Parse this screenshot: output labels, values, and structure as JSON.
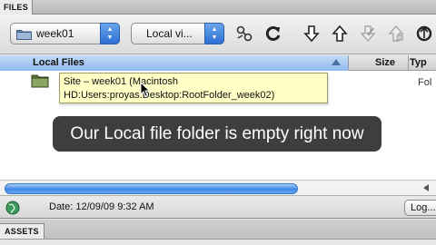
{
  "panel": {
    "tab_label": "FILES"
  },
  "toolbar": {
    "site_select": {
      "value": "week01",
      "icon": "folder-icon"
    },
    "view_select": {
      "value": "Local vi..."
    },
    "buttons": [
      {
        "name": "connect-icon"
      },
      {
        "name": "refresh-icon"
      },
      {
        "name": "get-files-icon"
      },
      {
        "name": "put-files-icon"
      },
      {
        "name": "check-out-icon"
      },
      {
        "name": "check-in-icon"
      },
      {
        "name": "synchronize-icon"
      }
    ]
  },
  "columns": {
    "local_files": "Local Files",
    "size": "Size",
    "type": "Typ"
  },
  "rows": [
    {
      "type": "Fol"
    }
  ],
  "tooltip": {
    "line1": "Site – week01 (Macintosh",
    "line2": "HD:Users:proyas:Desktop:RootFolder_week02)"
  },
  "caption": "Our Local file folder is empty right now",
  "status": {
    "date": "Date: 12/09/09 9:32 AM",
    "log_button": "Log..."
  },
  "assets_panel": {
    "tab_label": "ASSETS"
  },
  "colors": {
    "accent_blue": "#3d88e6",
    "tooltip_bg": "#ffffc6",
    "caption_bg": "#1e1e1e"
  }
}
